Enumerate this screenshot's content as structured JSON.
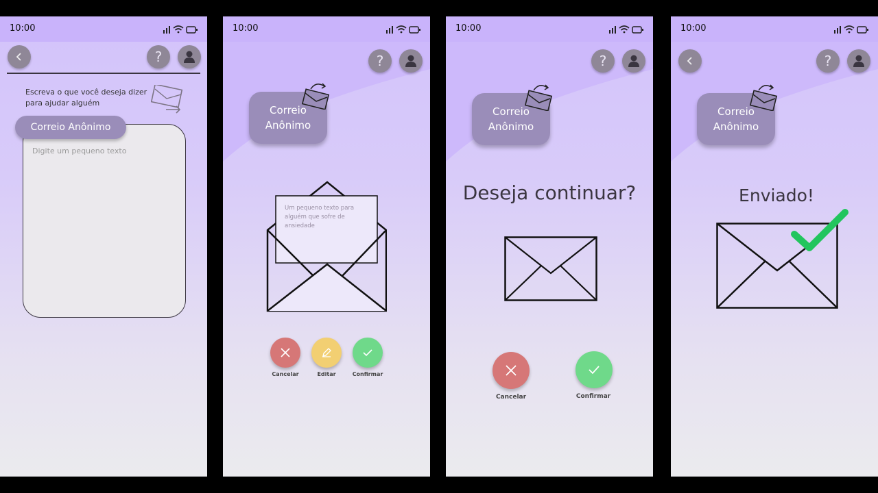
{
  "status_time": "10:00",
  "screen1": {
    "instruction": "Escreva o que você deseja dizer para ajudar alguém",
    "tab_label": "Correio Anônimo",
    "text_placeholder": "Digite um pequeno texto"
  },
  "screen2": {
    "brand": [
      "Correio",
      "Anônimo"
    ],
    "letter_text": "Um pequeno texto para alguém que sofre de ansiedade",
    "cancel_label": "Cancelar",
    "edit_label": "Editar",
    "confirm_label": "Confirmar"
  },
  "screen3": {
    "brand": [
      "Correio",
      "Anônimo"
    ],
    "question": "Deseja continuar?",
    "cancel_label": "Cancelar",
    "confirm_label": "Confirmar"
  },
  "screen4": {
    "brand": [
      "Correio",
      "Anônimo"
    ],
    "sent": "Enviado!"
  },
  "colors": {
    "status_bar": "#c9b3fb",
    "brand_button": "#9a8db9",
    "cancel": "#d67777",
    "edit": "#f2cf72",
    "confirm": "#6fd98a",
    "check": "#22c55e"
  }
}
